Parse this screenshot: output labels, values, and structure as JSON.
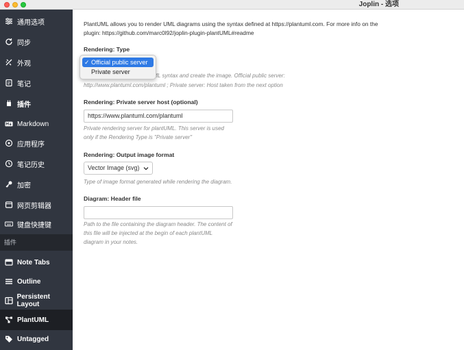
{
  "window": {
    "title": "Joplin - 选项"
  },
  "sidebar": {
    "items": [
      {
        "label": "通用选项",
        "icon": "sliders-icon"
      },
      {
        "label": "同步",
        "icon": "sync-icon"
      },
      {
        "label": "外观",
        "icon": "appearance-icon"
      },
      {
        "label": "笔记",
        "icon": "note-icon"
      },
      {
        "label": "插件",
        "icon": "plugin-icon"
      },
      {
        "label": "Markdown",
        "icon": "markdown-icon"
      },
      {
        "label": "应用程序",
        "icon": "app-icon"
      },
      {
        "label": "笔记历史",
        "icon": "history-icon"
      },
      {
        "label": "加密",
        "icon": "key-icon"
      },
      {
        "label": "网页剪辑器",
        "icon": "clipper-icon"
      },
      {
        "label": "键盘快捷键",
        "icon": "keyboard-icon"
      }
    ],
    "section_label": "插件",
    "plugins": [
      {
        "label": "Note Tabs",
        "icon": "tabs-icon"
      },
      {
        "label": "Outline",
        "icon": "outline-icon"
      },
      {
        "label": "Persistent Layout",
        "icon": "layout-icon"
      },
      {
        "label": "PlantUML",
        "icon": "plantuml-icon",
        "active": true
      },
      {
        "label": "Untagged",
        "icon": "tag-icon"
      }
    ]
  },
  "main": {
    "intro_line1": "PlantUML allows you to render UML diagrams using the syntax defined at https://plantuml.com. For more info on the",
    "intro_line2": "plugin: https://github.com/marc0l92/joplin-plugin-plantUML#readme",
    "rendering_type": {
      "label": "Rendering: Type",
      "desc_line1": "the PlantUML syntax and create the image. Official public server:",
      "desc_line2": "http://www.plantuml.com/plantuml ; Private server: Host taken from the next option",
      "options": [
        "Official public server",
        "Private server"
      ],
      "selected": "Official public server"
    },
    "private_host": {
      "label": "Rendering: Private server host (optional)",
      "value": "https://www.plantuml.com/plantuml",
      "desc_line1": "Private rendering server for plantUML. This server is used",
      "desc_line2": "only if the Rendering Type is \"Private server\""
    },
    "output_format": {
      "label": "Rendering: Output image format",
      "value": "Vector Image (svg)",
      "desc": "Type of image format generated while rendering the diagram."
    },
    "header_file": {
      "label": "Diagram: Header file",
      "value": "",
      "desc_line1": "Path to the file containing the diagram header. The content of",
      "desc_line2": "this file will be injected at the begin of each plantUML",
      "desc_line3": "diagram in your notes."
    }
  },
  "colors": {
    "sidebar_bg": "#313640",
    "sidebar_active": "#1d1f24",
    "accent": "#2f7ae5"
  }
}
